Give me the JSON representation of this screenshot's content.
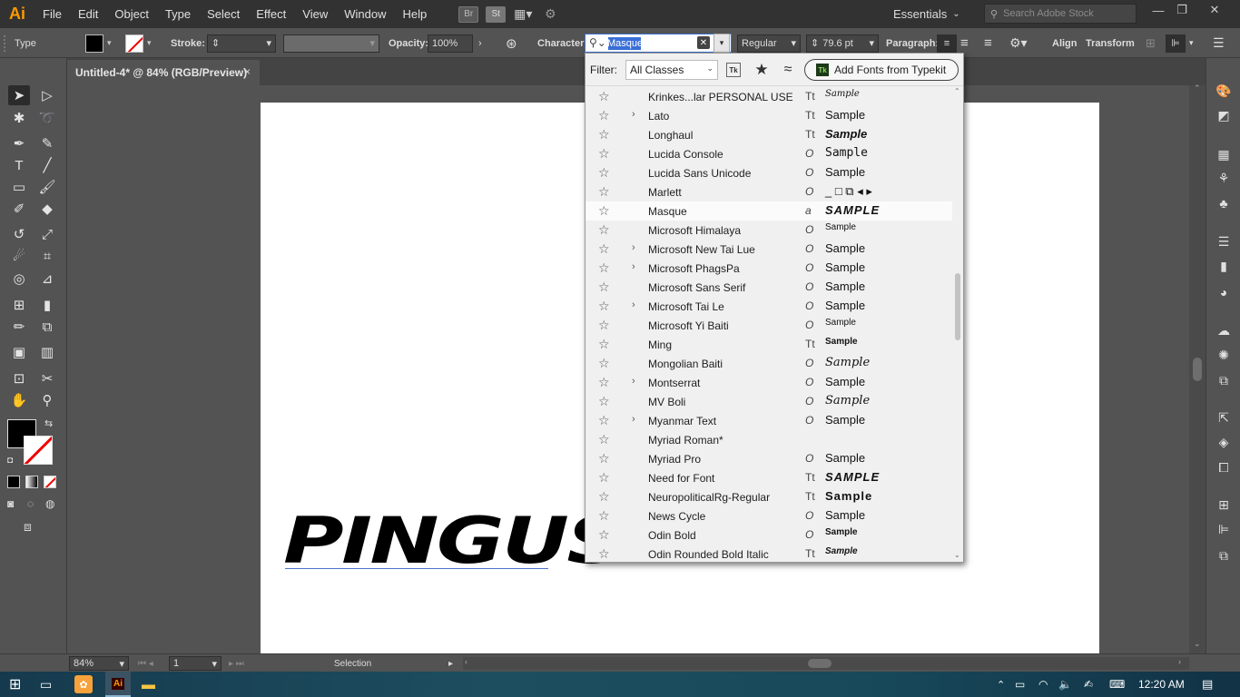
{
  "app": {
    "logo": "Ai",
    "menu": [
      "File",
      "Edit",
      "Object",
      "Type",
      "Select",
      "Effect",
      "View",
      "Window",
      "Help"
    ],
    "bridge_label": "Br",
    "stock_label": "St",
    "workspace": "Essentials",
    "stock_search_placeholder": "Search Adobe Stock"
  },
  "controlbar": {
    "type_label": "Type",
    "stroke_label": "Stroke:",
    "opacity_label": "Opacity:",
    "opacity_value": "100%",
    "character_label": "Character:",
    "font_search_value": "Masque",
    "font_style": "Regular",
    "font_size": "79.6 pt",
    "paragraph_label": "Paragraph:",
    "align_label": "Align",
    "transform_label": "Transform"
  },
  "document": {
    "tab_title": "Untitled-4* @ 84% (RGB/Preview)",
    "close": "×",
    "artboard_text": "PINGUS"
  },
  "font_panel": {
    "filter_label": "Filter:",
    "filter_value": "All Classes",
    "add_fonts_label": "Add Fonts from Typekit",
    "typekit_badge": "Tk",
    "fonts": [
      {
        "name": "Krinkes...lar PERSONAL USE",
        "type": "Tt",
        "sample": "Sample",
        "style": "script small",
        "chev": false
      },
      {
        "name": "Lato",
        "type": "Tt",
        "sample": "Sample",
        "style": "",
        "chev": true
      },
      {
        "name": "Longhaul",
        "type": "Tt",
        "sample": "Sample",
        "style": "bi",
        "chev": false
      },
      {
        "name": "Lucida Console",
        "type": "O",
        "sample": "Sample",
        "style": "mono",
        "chev": false
      },
      {
        "name": "Lucida Sans Unicode",
        "type": "O",
        "sample": "Sample",
        "style": "",
        "chev": false
      },
      {
        "name": "Marlett",
        "type": "O",
        "sample": "_ □ ⧉ ◂ ▸",
        "style": "",
        "chev": false
      },
      {
        "name": "Masque",
        "type": "a",
        "sample": "SAMPLE",
        "style": "bi wide",
        "chev": false,
        "active": true
      },
      {
        "name": "Microsoft Himalaya",
        "type": "O",
        "sample": "Sample",
        "style": "small",
        "chev": false
      },
      {
        "name": "Microsoft New Tai Lue",
        "type": "O",
        "sample": "Sample",
        "style": "",
        "chev": true
      },
      {
        "name": "Microsoft PhagsPa",
        "type": "O",
        "sample": "Sample",
        "style": "",
        "chev": true
      },
      {
        "name": "Microsoft Sans Serif",
        "type": "O",
        "sample": "Sample",
        "style": "",
        "chev": false
      },
      {
        "name": "Microsoft Tai Le",
        "type": "O",
        "sample": "Sample",
        "style": "",
        "chev": true
      },
      {
        "name": "Microsoft Yi Baiti",
        "type": "O",
        "sample": "Sample",
        "style": "small",
        "chev": false
      },
      {
        "name": "Ming",
        "type": "Tt",
        "sample": "Sample",
        "style": "b small",
        "chev": false
      },
      {
        "name": "Mongolian Baiti",
        "type": "O",
        "sample": "Sample",
        "style": "script",
        "chev": false
      },
      {
        "name": "Montserrat",
        "type": "O",
        "sample": "Sample",
        "style": "",
        "chev": true
      },
      {
        "name": "MV Boli",
        "type": "O",
        "sample": "Sample",
        "style": "script",
        "chev": false
      },
      {
        "name": "Myanmar Text",
        "type": "O",
        "sample": "Sample",
        "style": "",
        "chev": true
      },
      {
        "name": "Myriad Roman*",
        "type": "",
        "sample": "",
        "style": "",
        "chev": false
      },
      {
        "name": "Myriad Pro",
        "type": "O",
        "sample": "Sample",
        "style": "",
        "chev": false
      },
      {
        "name": "Need for Font",
        "type": "Tt",
        "sample": "SAMPLE",
        "style": "bi wide",
        "chev": false
      },
      {
        "name": "NeuropoliticalRg-Regular",
        "type": "Tt",
        "sample": "Sample",
        "style": "wide",
        "chev": false
      },
      {
        "name": "News Cycle",
        "type": "O",
        "sample": "Sample",
        "style": "",
        "chev": false
      },
      {
        "name": "Odin Bold",
        "type": "O",
        "sample": "Sample",
        "style": "b small",
        "chev": false
      },
      {
        "name": "Odin Rounded Bold Italic",
        "type": "Tt",
        "sample": "Sample",
        "style": "bi small",
        "chev": false
      }
    ]
  },
  "status": {
    "zoom": "84%",
    "artboard_num": "1",
    "tool_name": "Selection"
  },
  "taskbar": {
    "time": "12:20 AM"
  }
}
